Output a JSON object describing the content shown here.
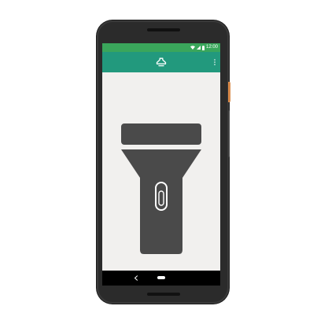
{
  "status_bar": {
    "time": "12:00",
    "icons": [
      "wifi-icon",
      "signal-icon",
      "battery-icon"
    ],
    "color": "#3aa65b"
  },
  "app_bar": {
    "icon": "flashlight-app-icon",
    "menu_icon": "overflow-menu-icon",
    "color": "#22997d"
  },
  "main": {
    "flashlight_icon": "flashlight-icon",
    "switch_icon": "power-switch-icon",
    "flashlight_color": "#4a4a4a",
    "background": "#f1f0ee"
  },
  "nav_bar": {
    "back_icon": "back-icon",
    "home_icon": "home-pill-icon"
  }
}
